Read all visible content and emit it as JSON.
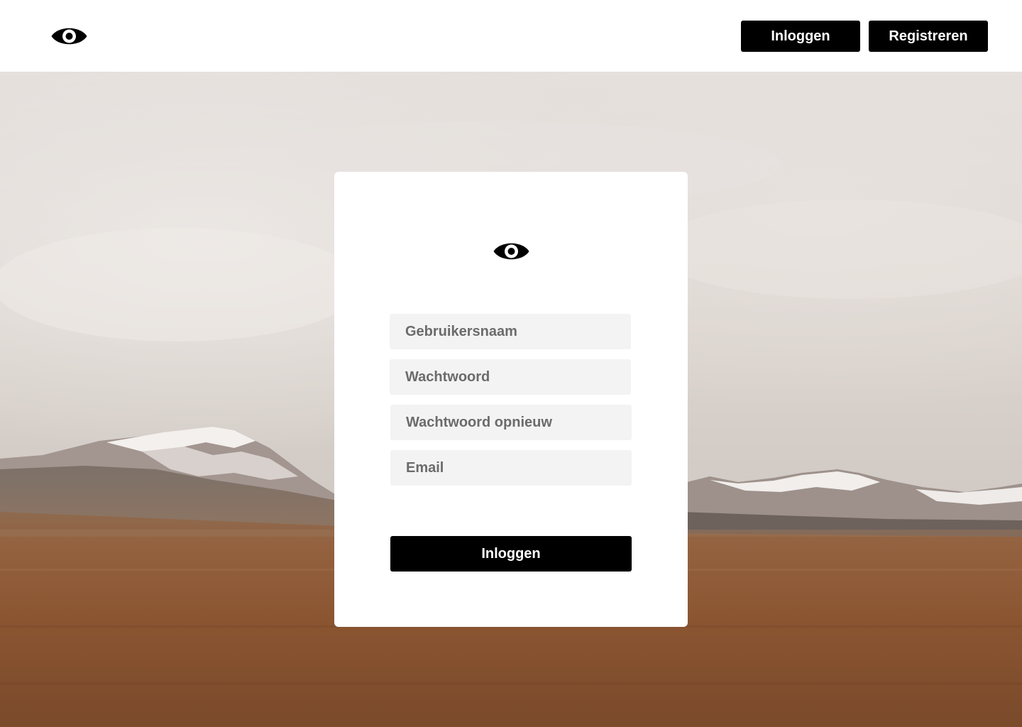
{
  "header": {
    "logo_icon": "eye-icon",
    "login_label": "Inloggen",
    "register_label": "Registreren"
  },
  "hero": {
    "background_image": "landscape-mountains-desert"
  },
  "form": {
    "logo_icon": "eye-icon",
    "username_placeholder": "Gebruikersnaam",
    "password_placeholder": "Wachtwoord",
    "password_repeat_placeholder": "Wachtwoord opnieuw",
    "email_placeholder": "Email",
    "submit_label": "Inloggen"
  },
  "colors": {
    "primary": "#000000",
    "button_text": "#ffffff",
    "field_background": "#f3f3f3",
    "placeholder": "#6b6b6b"
  }
}
